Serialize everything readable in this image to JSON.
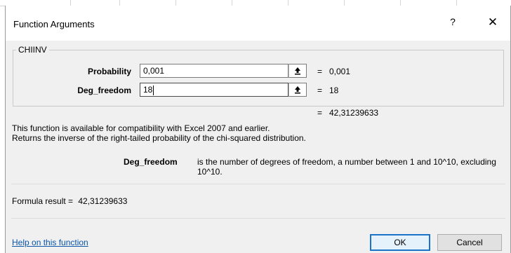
{
  "dialog": {
    "title": "Function Arguments",
    "help_glyph": "?",
    "close_glyph": "✕"
  },
  "function": {
    "name": "CHIINV",
    "arguments": [
      {
        "label": "Probability",
        "input": "0,001",
        "equals": "=",
        "evaluated": "0,001"
      },
      {
        "label": "Deg_freedom",
        "input": "18",
        "equals": "=",
        "evaluated": "18"
      }
    ],
    "result_equals": "=",
    "result_value": "42,31239633",
    "description_line1": "This function is available for compatibility with Excel 2007 and earlier.",
    "description_line2": "Returns the inverse of the right-tailed probability of the chi-squared distribution.",
    "param_name": "Deg_freedom",
    "param_description": "is the number of degrees of freedom, a number between 1 and 10^10, excluding 10^10."
  },
  "footer": {
    "formula_result_label": "Formula result =",
    "formula_result_value": "42,31239633",
    "help_link": "Help on this function",
    "ok_label": "OK",
    "cancel_label": "Cancel"
  },
  "icons": {
    "collapse": "collapse-dialog-icon",
    "help": "help-icon",
    "close": "close-icon"
  },
  "colors": {
    "dialog_bg": "#f0f0f0",
    "link": "#0a55a8",
    "ok_border": "#1a73c8"
  }
}
